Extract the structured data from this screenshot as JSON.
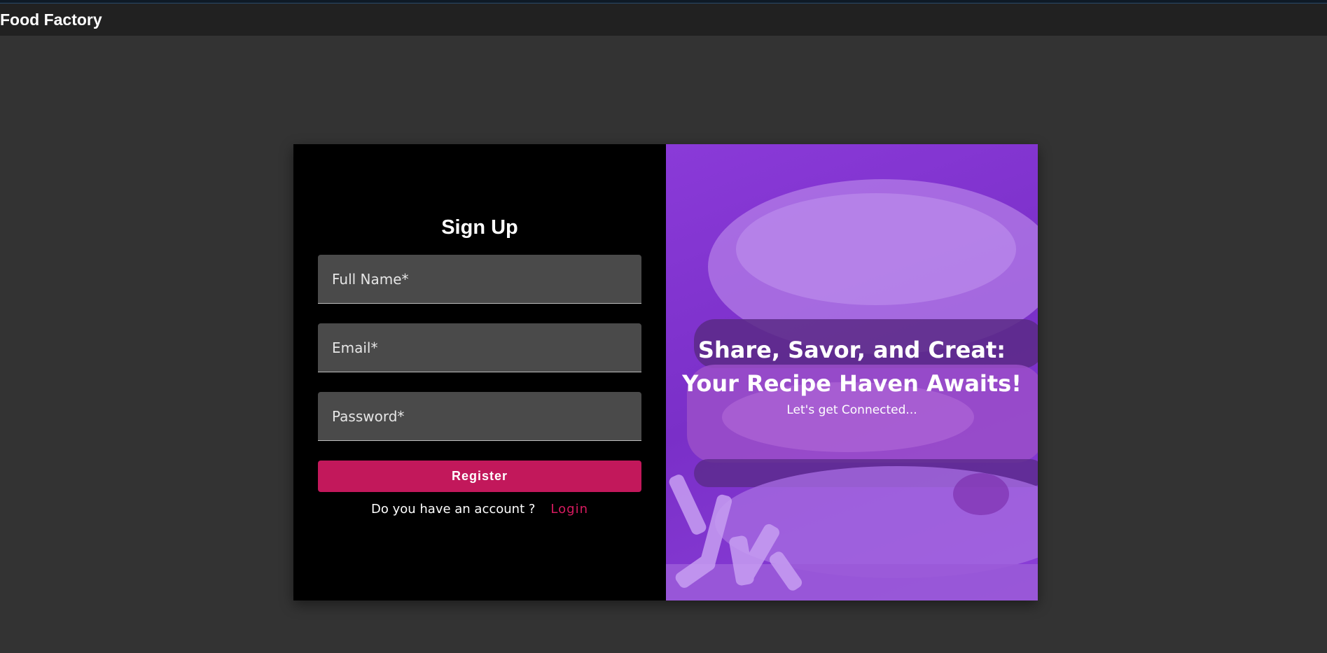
{
  "app": {
    "brand": "Food Factory"
  },
  "signup": {
    "title": "Sign Up",
    "fields": {
      "full_name": {
        "placeholder": "Full Name*",
        "value": ""
      },
      "email": {
        "placeholder": "Email*",
        "value": ""
      },
      "password": {
        "placeholder": "Password*",
        "value": ""
      }
    },
    "register_label": "Register",
    "account_question": "Do you have an account ?",
    "login_label": "Login"
  },
  "hero": {
    "headline": "Share, Savor, and Creat: Your Recipe Haven Awaits!",
    "subtext": "Let's get Connected..."
  },
  "colors": {
    "background": "#333333",
    "appbar": "#212121",
    "panel": "#000000",
    "accent": "#c2185b",
    "overlay": "#8a3ad8"
  }
}
